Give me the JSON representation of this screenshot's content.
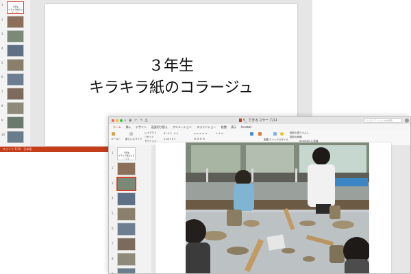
{
  "back_window": {
    "slide": {
      "title_line1": "３年生",
      "title_line2": "キラキラ紙のコラージュ"
    },
    "sidebar": {
      "thumbnails": [
        {
          "num": "1",
          "kind": "title",
          "title": "３年生\nキラキラ紙のコラージュ"
        },
        {
          "num": "2",
          "kind": "photo"
        },
        {
          "num": "3",
          "kind": "photo"
        },
        {
          "num": "4",
          "kind": "photo"
        },
        {
          "num": "5",
          "kind": "photo"
        },
        {
          "num": "6",
          "kind": "photo"
        },
        {
          "num": "7",
          "kind": "photo"
        },
        {
          "num": "8",
          "kind": "photo"
        },
        {
          "num": "9",
          "kind": "photo"
        },
        {
          "num": "10",
          "kind": "photo"
        }
      ]
    },
    "status_bar": {
      "text": "スライド 1/10　日本語",
      "color": "#c43e1c"
    }
  },
  "front_window": {
    "title_bar": {
      "document_title": "5_ できるコラー 7/11"
    },
    "search": {
      "placeholder": "プレゼンテーション内を検索"
    },
    "ribbon_tabs": [
      {
        "label": "ホーム",
        "active": true
      },
      {
        "label": "挿入",
        "active": false
      },
      {
        "label": "デザイン",
        "active": false
      },
      {
        "label": "画面切り替え",
        "active": false
      },
      {
        "label": "アニメーション",
        "active": false
      },
      {
        "label": "スライドショー",
        "active": false
      },
      {
        "label": "校閲",
        "active": false
      },
      {
        "label": "表示",
        "active": false
      },
      {
        "label": "Acrobat",
        "active": false
      }
    ],
    "ribbon": {
      "paste": "ペースト",
      "new_slide": "新しいスライド",
      "layout": "レイアウト",
      "reset": "リセット",
      "section": "セクション",
      "arrange": "配置",
      "quick_styles": "クイックスタイル",
      "shape_fill": "図形の塗りつぶし",
      "shape_outline": "図形の枠線",
      "convert_smartart": "SmartArt に変換"
    },
    "sidebar": {
      "thumbnails": [
        {
          "num": "1",
          "kind": "title",
          "title": "３年生\nキラキラ紙のコラージュ",
          "active": false
        },
        {
          "num": "2",
          "kind": "photo",
          "active": false
        },
        {
          "num": "3",
          "kind": "photo",
          "active": true
        },
        {
          "num": "4",
          "kind": "photo",
          "active": false
        },
        {
          "num": "5",
          "kind": "photo",
          "active": false
        },
        {
          "num": "6",
          "kind": "photo",
          "active": false
        },
        {
          "num": "7",
          "kind": "photo",
          "active": false
        },
        {
          "num": "8",
          "kind": "photo",
          "active": false
        },
        {
          "num": "9",
          "kind": "photo",
          "active": false
        }
      ]
    }
  },
  "colors": {
    "accent": "#c43e1c",
    "selection": "#d0462c"
  }
}
